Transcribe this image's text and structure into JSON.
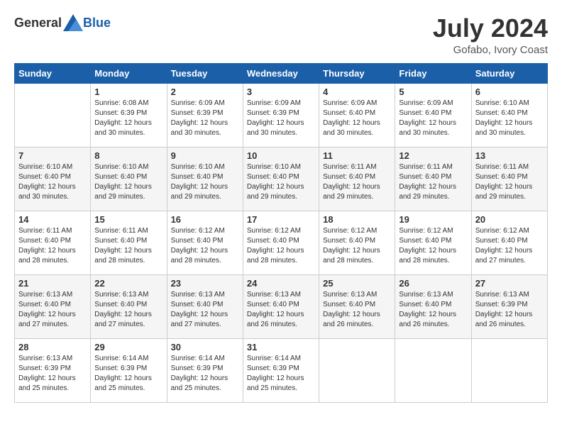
{
  "header": {
    "logo_general": "General",
    "logo_blue": "Blue",
    "month": "July 2024",
    "location": "Gofabo, Ivory Coast"
  },
  "days_of_week": [
    "Sunday",
    "Monday",
    "Tuesday",
    "Wednesday",
    "Thursday",
    "Friday",
    "Saturday"
  ],
  "weeks": [
    [
      {
        "day": "",
        "sunrise": "",
        "sunset": "",
        "daylight": ""
      },
      {
        "day": "1",
        "sunrise": "Sunrise: 6:08 AM",
        "sunset": "Sunset: 6:39 PM",
        "daylight": "Daylight: 12 hours and 30 minutes."
      },
      {
        "day": "2",
        "sunrise": "Sunrise: 6:09 AM",
        "sunset": "Sunset: 6:39 PM",
        "daylight": "Daylight: 12 hours and 30 minutes."
      },
      {
        "day": "3",
        "sunrise": "Sunrise: 6:09 AM",
        "sunset": "Sunset: 6:39 PM",
        "daylight": "Daylight: 12 hours and 30 minutes."
      },
      {
        "day": "4",
        "sunrise": "Sunrise: 6:09 AM",
        "sunset": "Sunset: 6:40 PM",
        "daylight": "Daylight: 12 hours and 30 minutes."
      },
      {
        "day": "5",
        "sunrise": "Sunrise: 6:09 AM",
        "sunset": "Sunset: 6:40 PM",
        "daylight": "Daylight: 12 hours and 30 minutes."
      },
      {
        "day": "6",
        "sunrise": "Sunrise: 6:10 AM",
        "sunset": "Sunset: 6:40 PM",
        "daylight": "Daylight: 12 hours and 30 minutes."
      }
    ],
    [
      {
        "day": "7",
        "sunrise": "Sunrise: 6:10 AM",
        "sunset": "Sunset: 6:40 PM",
        "daylight": "Daylight: 12 hours and 30 minutes."
      },
      {
        "day": "8",
        "sunrise": "Sunrise: 6:10 AM",
        "sunset": "Sunset: 6:40 PM",
        "daylight": "Daylight: 12 hours and 29 minutes."
      },
      {
        "day": "9",
        "sunrise": "Sunrise: 6:10 AM",
        "sunset": "Sunset: 6:40 PM",
        "daylight": "Daylight: 12 hours and 29 minutes."
      },
      {
        "day": "10",
        "sunrise": "Sunrise: 6:10 AM",
        "sunset": "Sunset: 6:40 PM",
        "daylight": "Daylight: 12 hours and 29 minutes."
      },
      {
        "day": "11",
        "sunrise": "Sunrise: 6:11 AM",
        "sunset": "Sunset: 6:40 PM",
        "daylight": "Daylight: 12 hours and 29 minutes."
      },
      {
        "day": "12",
        "sunrise": "Sunrise: 6:11 AM",
        "sunset": "Sunset: 6:40 PM",
        "daylight": "Daylight: 12 hours and 29 minutes."
      },
      {
        "day": "13",
        "sunrise": "Sunrise: 6:11 AM",
        "sunset": "Sunset: 6:40 PM",
        "daylight": "Daylight: 12 hours and 29 minutes."
      }
    ],
    [
      {
        "day": "14",
        "sunrise": "Sunrise: 6:11 AM",
        "sunset": "Sunset: 6:40 PM",
        "daylight": "Daylight: 12 hours and 28 minutes."
      },
      {
        "day": "15",
        "sunrise": "Sunrise: 6:11 AM",
        "sunset": "Sunset: 6:40 PM",
        "daylight": "Daylight: 12 hours and 28 minutes."
      },
      {
        "day": "16",
        "sunrise": "Sunrise: 6:12 AM",
        "sunset": "Sunset: 6:40 PM",
        "daylight": "Daylight: 12 hours and 28 minutes."
      },
      {
        "day": "17",
        "sunrise": "Sunrise: 6:12 AM",
        "sunset": "Sunset: 6:40 PM",
        "daylight": "Daylight: 12 hours and 28 minutes."
      },
      {
        "day": "18",
        "sunrise": "Sunrise: 6:12 AM",
        "sunset": "Sunset: 6:40 PM",
        "daylight": "Daylight: 12 hours and 28 minutes."
      },
      {
        "day": "19",
        "sunrise": "Sunrise: 6:12 AM",
        "sunset": "Sunset: 6:40 PM",
        "daylight": "Daylight: 12 hours and 28 minutes."
      },
      {
        "day": "20",
        "sunrise": "Sunrise: 6:12 AM",
        "sunset": "Sunset: 6:40 PM",
        "daylight": "Daylight: 12 hours and 27 minutes."
      }
    ],
    [
      {
        "day": "21",
        "sunrise": "Sunrise: 6:13 AM",
        "sunset": "Sunset: 6:40 PM",
        "daylight": "Daylight: 12 hours and 27 minutes."
      },
      {
        "day": "22",
        "sunrise": "Sunrise: 6:13 AM",
        "sunset": "Sunset: 6:40 PM",
        "daylight": "Daylight: 12 hours and 27 minutes."
      },
      {
        "day": "23",
        "sunrise": "Sunrise: 6:13 AM",
        "sunset": "Sunset: 6:40 PM",
        "daylight": "Daylight: 12 hours and 27 minutes."
      },
      {
        "day": "24",
        "sunrise": "Sunrise: 6:13 AM",
        "sunset": "Sunset: 6:40 PM",
        "daylight": "Daylight: 12 hours and 26 minutes."
      },
      {
        "day": "25",
        "sunrise": "Sunrise: 6:13 AM",
        "sunset": "Sunset: 6:40 PM",
        "daylight": "Daylight: 12 hours and 26 minutes."
      },
      {
        "day": "26",
        "sunrise": "Sunrise: 6:13 AM",
        "sunset": "Sunset: 6:40 PM",
        "daylight": "Daylight: 12 hours and 26 minutes."
      },
      {
        "day": "27",
        "sunrise": "Sunrise: 6:13 AM",
        "sunset": "Sunset: 6:39 PM",
        "daylight": "Daylight: 12 hours and 26 minutes."
      }
    ],
    [
      {
        "day": "28",
        "sunrise": "Sunrise: 6:13 AM",
        "sunset": "Sunset: 6:39 PM",
        "daylight": "Daylight: 12 hours and 25 minutes."
      },
      {
        "day": "29",
        "sunrise": "Sunrise: 6:14 AM",
        "sunset": "Sunset: 6:39 PM",
        "daylight": "Daylight: 12 hours and 25 minutes."
      },
      {
        "day": "30",
        "sunrise": "Sunrise: 6:14 AM",
        "sunset": "Sunset: 6:39 PM",
        "daylight": "Daylight: 12 hours and 25 minutes."
      },
      {
        "day": "31",
        "sunrise": "Sunrise: 6:14 AM",
        "sunset": "Sunset: 6:39 PM",
        "daylight": "Daylight: 12 hours and 25 minutes."
      },
      {
        "day": "",
        "sunrise": "",
        "sunset": "",
        "daylight": ""
      },
      {
        "day": "",
        "sunrise": "",
        "sunset": "",
        "daylight": ""
      },
      {
        "day": "",
        "sunrise": "",
        "sunset": "",
        "daylight": ""
      }
    ]
  ]
}
